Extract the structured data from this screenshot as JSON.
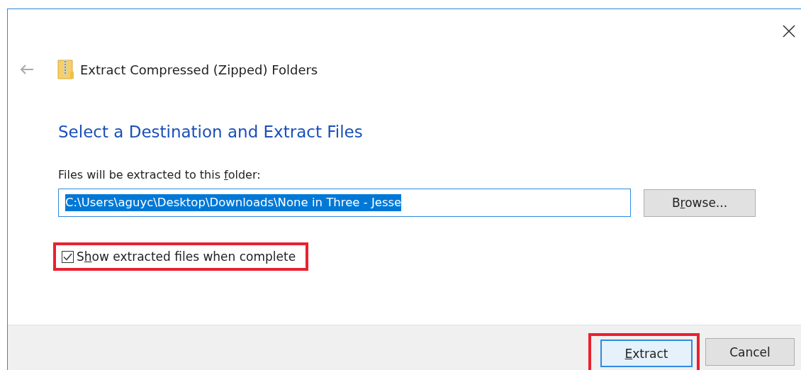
{
  "window": {
    "title": "Extract Compressed (Zipped) Folders"
  },
  "heading": "Select a Destination and Extract Files",
  "destination": {
    "label": {
      "before": "Files will be extracted to this ",
      "key": "f",
      "after": "older:"
    },
    "value": "C:\\Users\\aguyc\\Desktop\\Downloads\\None in Three - Jesse",
    "selected": true
  },
  "browse_button": {
    "before": "B",
    "key": "r",
    "after": "owse..."
  },
  "show_files": {
    "label": {
      "before": "S",
      "key": "h",
      "after": "ow extracted files when complete"
    },
    "checked": true,
    "highlighted": true
  },
  "buttons": [
    {
      "label": {
        "key": "E",
        "after": "xtract"
      },
      "kind": "default",
      "highlighted": true
    },
    {
      "label": {
        "before": "Cancel"
      },
      "kind": "normal",
      "highlighted": false
    }
  ]
}
